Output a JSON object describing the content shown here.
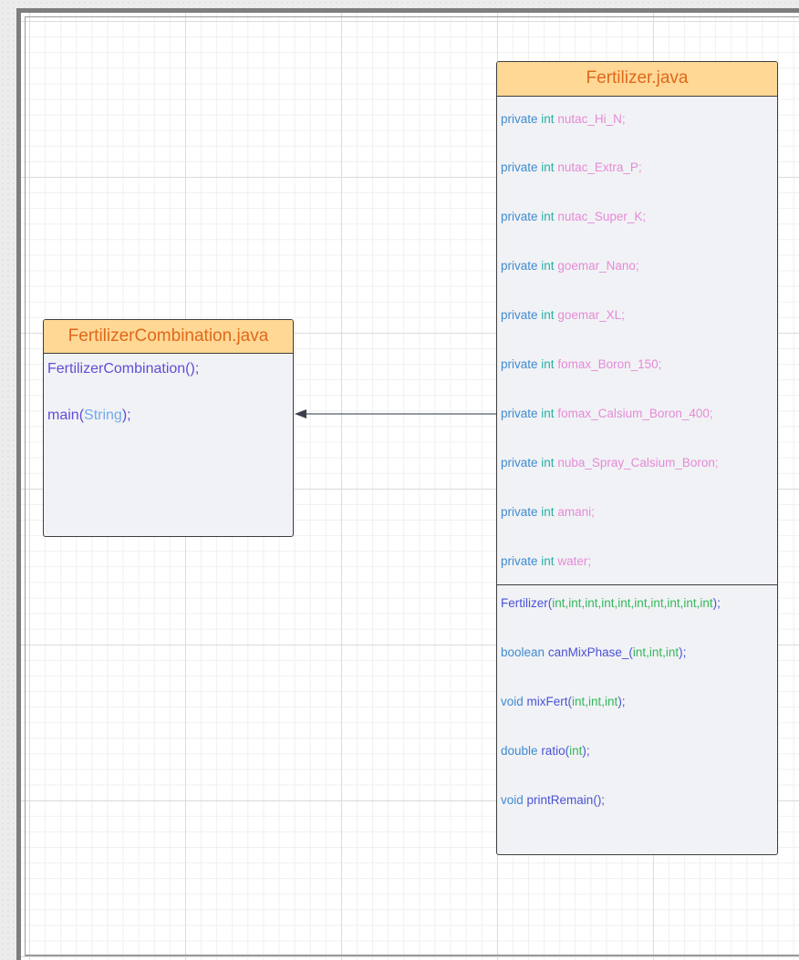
{
  "diagram": {
    "classes": [
      {
        "id": "fertilizer_combination",
        "name": "FertilizerCombination.java",
        "operations": [
          {
            "name": "FertilizerCombination",
            "params": [],
            "suffix": "();"
          },
          {
            "name": "main",
            "params": [
              "String"
            ],
            "suffix": ");"
          }
        ]
      },
      {
        "id": "fertilizer",
        "name": "Fertilizer.java",
        "attributes": [
          {
            "visibility": "private",
            "type": "int",
            "name": "nutac_Hi_N;"
          },
          {
            "visibility": "private",
            "type": "int",
            "name": "nutac_Extra_P;"
          },
          {
            "visibility": "private",
            "type": "int",
            "name": "nutac_Super_K;"
          },
          {
            "visibility": "private",
            "type": "int",
            "name": "goemar_Nano;"
          },
          {
            "visibility": "private",
            "type": "int",
            "name": "goemar_XL;"
          },
          {
            "visibility": "private",
            "type": "int",
            "name": "fomax_Boron_150;"
          },
          {
            "visibility": "private",
            "type": "int",
            "name": "fomax_Calsium_Boron_400;"
          },
          {
            "visibility": "private",
            "type": "int",
            "name": "nuba_Spray_Calsium_Boron;"
          },
          {
            "visibility": "private",
            "type": "int",
            "name": "amani;"
          },
          {
            "visibility": "private",
            "type": "int",
            "name": "water;"
          }
        ],
        "operations": [
          {
            "return_type": "",
            "name": "Fertilizer",
            "args": "int,int,int,int,int,int,int,int,int,int",
            "suffix": ");"
          },
          {
            "return_type": "boolean",
            "name": "canMixPhase_",
            "args": "int,int,int",
            "suffix": ");"
          },
          {
            "return_type": "void",
            "name": "mixFert",
            "args": "int,int,int",
            "suffix": ");"
          },
          {
            "return_type": "double",
            "name": "ratio",
            "args": "int",
            "suffix": ");"
          },
          {
            "return_type": "void",
            "name": "printRemain",
            "args": "",
            "suffix": ");"
          }
        ]
      }
    ],
    "relationships": [
      {
        "from": "fertilizer",
        "to": "fertilizer_combination",
        "type": "association",
        "arrow": "filled-triangle"
      }
    ],
    "colors": {
      "header_fill": "#ffd896",
      "header_text": "#e0681a",
      "box_fill": "#f1f2f5",
      "border": "#3d3d3d",
      "keyword": "#3f8bd0",
      "type": "#27b0a6",
      "field_name": "#e58ad8",
      "method_name": "#4a52d6",
      "argument": "#34b85c"
    }
  }
}
